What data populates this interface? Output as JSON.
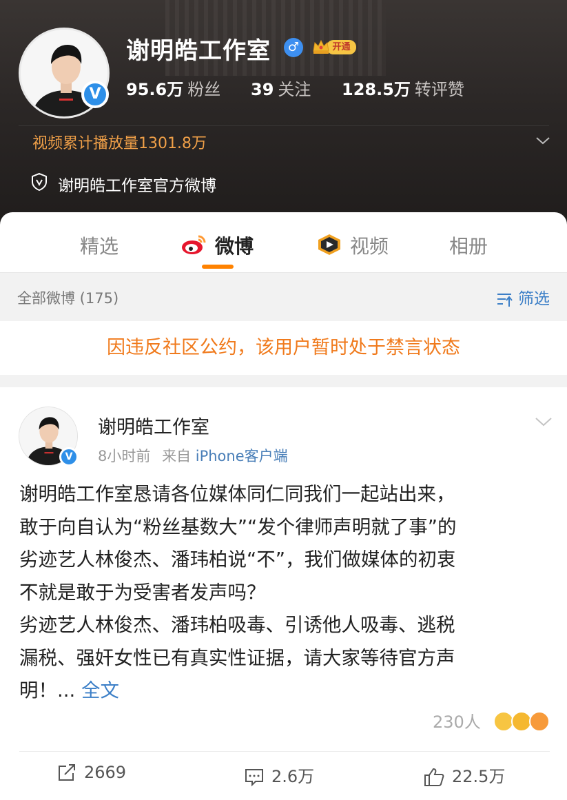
{
  "profile": {
    "name": "谢明皓工作室",
    "gender_symbol": "♂",
    "vip_label": "开通",
    "verified_mark": "V",
    "stats": [
      {
        "num": "95.6万",
        "label": "粉丝"
      },
      {
        "num": "39",
        "label": "关注"
      },
      {
        "num": "128.5万",
        "label": "转评赞"
      }
    ],
    "play_count": "视频累计播放量1301.8万",
    "official_text": "谢明皓工作室官方微博"
  },
  "tabs": [
    {
      "label": "精选",
      "active": false
    },
    {
      "label": "微博",
      "active": true
    },
    {
      "label": "视频",
      "active": false
    },
    {
      "label": "相册",
      "active": false
    }
  ],
  "filter": {
    "count_text": "全部微博 (175)",
    "button_label": "筛选"
  },
  "notice": "因违反社区公约，该用户暂时处于禁言状态",
  "post": {
    "author": "谢明皓工作室",
    "time": "8小时前",
    "source_prefix": "来自",
    "source": "iPhone客户端",
    "lines": [
      "谢明皓工作室恳请各位媒体同仁同我们一起站出来，",
      "敢于向自认为“粉丝基数大”“发个律师声明就了事”的",
      "劣迹艺人林俊杰、潘玮柏说“不”，我们做媒体的初衷",
      "不就是敢于为受害者发声吗？",
      "劣迹艺人林俊杰、潘玮柏吸毒、引诱他人吸毒、逃税",
      "漏税、强奸女性已有真实性证据，请大家等待官方声"
    ],
    "last_line_text": "明！...",
    "more_label": "全文",
    "reaction_count": "230人",
    "actions": {
      "repost": "2669",
      "comment": "2.6万",
      "like": "22.5万"
    }
  },
  "colors": {
    "accent_orange": "#ff8200",
    "link_blue": "#3c7fc7",
    "verified_blue": "#2e8fe8",
    "notice_orange": "#f07a1c"
  }
}
